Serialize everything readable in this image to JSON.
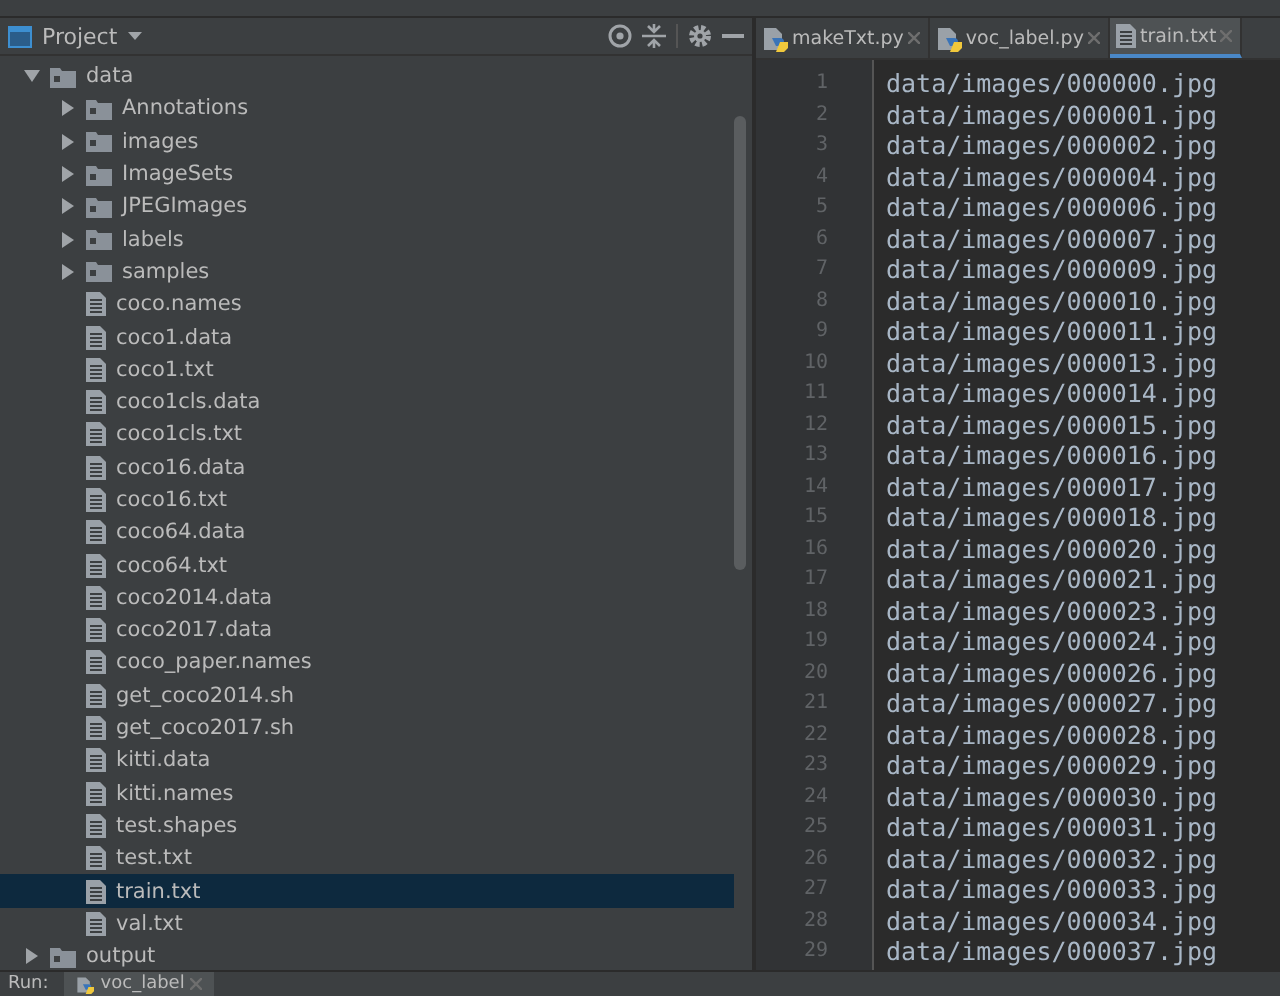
{
  "project_panel": {
    "title": "Project",
    "tree": [
      {
        "kind": "folder",
        "label": "data",
        "expanded": true,
        "selected": false,
        "children": [
          {
            "kind": "folder",
            "label": "Annotations",
            "expanded": false,
            "selected": false
          },
          {
            "kind": "folder",
            "label": "images",
            "expanded": false,
            "selected": false
          },
          {
            "kind": "folder",
            "label": "ImageSets",
            "expanded": false,
            "selected": false
          },
          {
            "kind": "folder",
            "label": "JPEGImages",
            "expanded": false,
            "selected": false
          },
          {
            "kind": "folder",
            "label": "labels",
            "expanded": false,
            "selected": false
          },
          {
            "kind": "folder",
            "label": "samples",
            "expanded": false,
            "selected": false
          },
          {
            "kind": "file",
            "label": "coco.names",
            "selected": false
          },
          {
            "kind": "file",
            "label": "coco1.data",
            "selected": false
          },
          {
            "kind": "file",
            "label": "coco1.txt",
            "selected": false
          },
          {
            "kind": "file",
            "label": "coco1cls.data",
            "selected": false
          },
          {
            "kind": "file",
            "label": "coco1cls.txt",
            "selected": false
          },
          {
            "kind": "file",
            "label": "coco16.data",
            "selected": false
          },
          {
            "kind": "file",
            "label": "coco16.txt",
            "selected": false
          },
          {
            "kind": "file",
            "label": "coco64.data",
            "selected": false
          },
          {
            "kind": "file",
            "label": "coco64.txt",
            "selected": false
          },
          {
            "kind": "file",
            "label": "coco2014.data",
            "selected": false
          },
          {
            "kind": "file",
            "label": "coco2017.data",
            "selected": false
          },
          {
            "kind": "file",
            "label": "coco_paper.names",
            "selected": false
          },
          {
            "kind": "file",
            "label": "get_coco2014.sh",
            "selected": false
          },
          {
            "kind": "file",
            "label": "get_coco2017.sh",
            "selected": false
          },
          {
            "kind": "file",
            "label": "kitti.data",
            "selected": false
          },
          {
            "kind": "file",
            "label": "kitti.names",
            "selected": false
          },
          {
            "kind": "file",
            "label": "test.shapes",
            "selected": false
          },
          {
            "kind": "file",
            "label": "test.txt",
            "selected": false
          },
          {
            "kind": "file",
            "label": "train.txt",
            "selected": true
          },
          {
            "kind": "file",
            "label": "val.txt",
            "selected": false
          }
        ]
      },
      {
        "kind": "folder",
        "label": "output",
        "expanded": false,
        "selected": false
      }
    ]
  },
  "editor": {
    "tabs": [
      {
        "kind": "python",
        "label": "makeTxt.py",
        "selected": false
      },
      {
        "kind": "python",
        "label": "voc_label.py",
        "selected": false
      },
      {
        "kind": "text",
        "label": "train.txt",
        "selected": true
      }
    ],
    "lines": [
      {
        "number": "1",
        "text": "data/images/000000.jpg"
      },
      {
        "number": "2",
        "text": "data/images/000001.jpg"
      },
      {
        "number": "3",
        "text": "data/images/000002.jpg"
      },
      {
        "number": "4",
        "text": "data/images/000004.jpg"
      },
      {
        "number": "5",
        "text": "data/images/000006.jpg"
      },
      {
        "number": "6",
        "text": "data/images/000007.jpg"
      },
      {
        "number": "7",
        "text": "data/images/000009.jpg"
      },
      {
        "number": "8",
        "text": "data/images/000010.jpg"
      },
      {
        "number": "9",
        "text": "data/images/000011.jpg"
      },
      {
        "number": "10",
        "text": "data/images/000013.jpg"
      },
      {
        "number": "11",
        "text": "data/images/000014.jpg"
      },
      {
        "number": "12",
        "text": "data/images/000015.jpg"
      },
      {
        "number": "13",
        "text": "data/images/000016.jpg"
      },
      {
        "number": "14",
        "text": "data/images/000017.jpg"
      },
      {
        "number": "15",
        "text": "data/images/000018.jpg"
      },
      {
        "number": "16",
        "text": "data/images/000020.jpg"
      },
      {
        "number": "17",
        "text": "data/images/000021.jpg"
      },
      {
        "number": "18",
        "text": "data/images/000023.jpg"
      },
      {
        "number": "19",
        "text": "data/images/000024.jpg"
      },
      {
        "number": "20",
        "text": "data/images/000026.jpg"
      },
      {
        "number": "21",
        "text": "data/images/000027.jpg"
      },
      {
        "number": "22",
        "text": "data/images/000028.jpg"
      },
      {
        "number": "23",
        "text": "data/images/000029.jpg"
      },
      {
        "number": "24",
        "text": "data/images/000030.jpg"
      },
      {
        "number": "25",
        "text": "data/images/000031.jpg"
      },
      {
        "number": "26",
        "text": "data/images/000032.jpg"
      },
      {
        "number": "27",
        "text": "data/images/000033.jpg"
      },
      {
        "number": "28",
        "text": "data/images/000034.jpg"
      },
      {
        "number": "29",
        "text": "data/images/000037.jpg"
      }
    ]
  },
  "run_bar": {
    "label": "Run:",
    "tabs": [
      {
        "kind": "python",
        "label": "voc_label",
        "selected": true
      }
    ]
  }
}
